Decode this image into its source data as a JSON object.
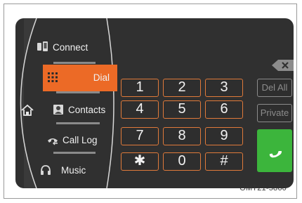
{
  "menu": {
    "items": [
      {
        "label": "Connect",
        "icon": "phone-connect-icon"
      },
      {
        "label": "Dial",
        "icon": "keypad-icon",
        "active": true
      },
      {
        "label": "Contacts",
        "icon": "contacts-icon"
      },
      {
        "label": "Call Log",
        "icon": "call-log-icon"
      },
      {
        "label": "Music",
        "icon": "headphones-icon"
      }
    ],
    "home_icon": "home-icon"
  },
  "keypad": {
    "keys": [
      "1",
      "2",
      "3",
      "4",
      "5",
      "6",
      "7",
      "8",
      "9",
      "✱",
      "0",
      "#"
    ]
  },
  "side": {
    "del_all": "Del All",
    "private": "Private",
    "backspace_icon": "backspace-icon",
    "call_icon": "call-icon"
  },
  "caption": "OMT21-5860",
  "colors": {
    "accent": "#ec6a26",
    "call": "#3cb53c",
    "background": "#303030"
  }
}
